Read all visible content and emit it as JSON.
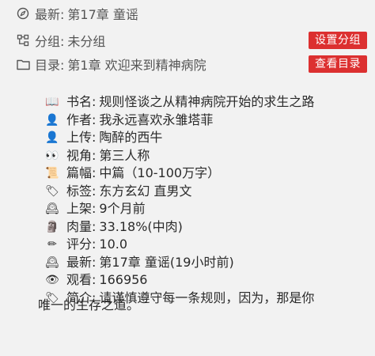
{
  "header": {
    "latest": {
      "label": "最新:",
      "value": "第17章 童谣",
      "icon": "compass-icon"
    },
    "group": {
      "label": "分组:",
      "value": "未分组",
      "icon": "nodes-icon",
      "button": "设置分组"
    },
    "toc": {
      "label": "目录:",
      "value": "第1章 欢迎来到精神病院",
      "icon": "folder-icon",
      "button": "查看目录"
    }
  },
  "info": {
    "title": {
      "icon": "📖",
      "label": "书名:",
      "value": "规则怪谈之从精神病院开始的求生之路"
    },
    "author": {
      "icon": "👤",
      "label": "作者:",
      "value": "我永远喜欢永雏塔菲"
    },
    "uploader": {
      "icon": "👤",
      "label": "上传:",
      "value": "陶醉的西牛"
    },
    "pov": {
      "icon": "👀",
      "label": "视角:",
      "value": "第三人称"
    },
    "length": {
      "icon": "📜",
      "label": "篇幅:",
      "value": "中篇（10-100万字）"
    },
    "tags": {
      "icon": "🏷",
      "label": "标签:",
      "value": "东方玄幻 直男文"
    },
    "shelved": {
      "icon": "🕰",
      "label": "上架:",
      "value": "9个月前"
    },
    "meat": {
      "icon": "🗿",
      "label": "肉量:",
      "value": "33.18%(中肉)"
    },
    "rating": {
      "icon": "✏",
      "label": "评分:",
      "value": "10.0"
    },
    "latest": {
      "icon": "🕰",
      "label": "最新:",
      "value": "第17章 童谣(19小时前)"
    },
    "views": {
      "icon": "👁",
      "label": "观看:",
      "value": "166956"
    },
    "intro": {
      "icon": "🏷",
      "label": "简介:",
      "value": "请谨慎遵守每一条规则，因为，那是你",
      "value_cont": "唯一的生存之道。"
    }
  },
  "colors": {
    "background": "#f2f2f2",
    "button": "#dc3030",
    "button_text": "#ffffff",
    "muted": "#555555",
    "text": "#2a2a2a"
  }
}
